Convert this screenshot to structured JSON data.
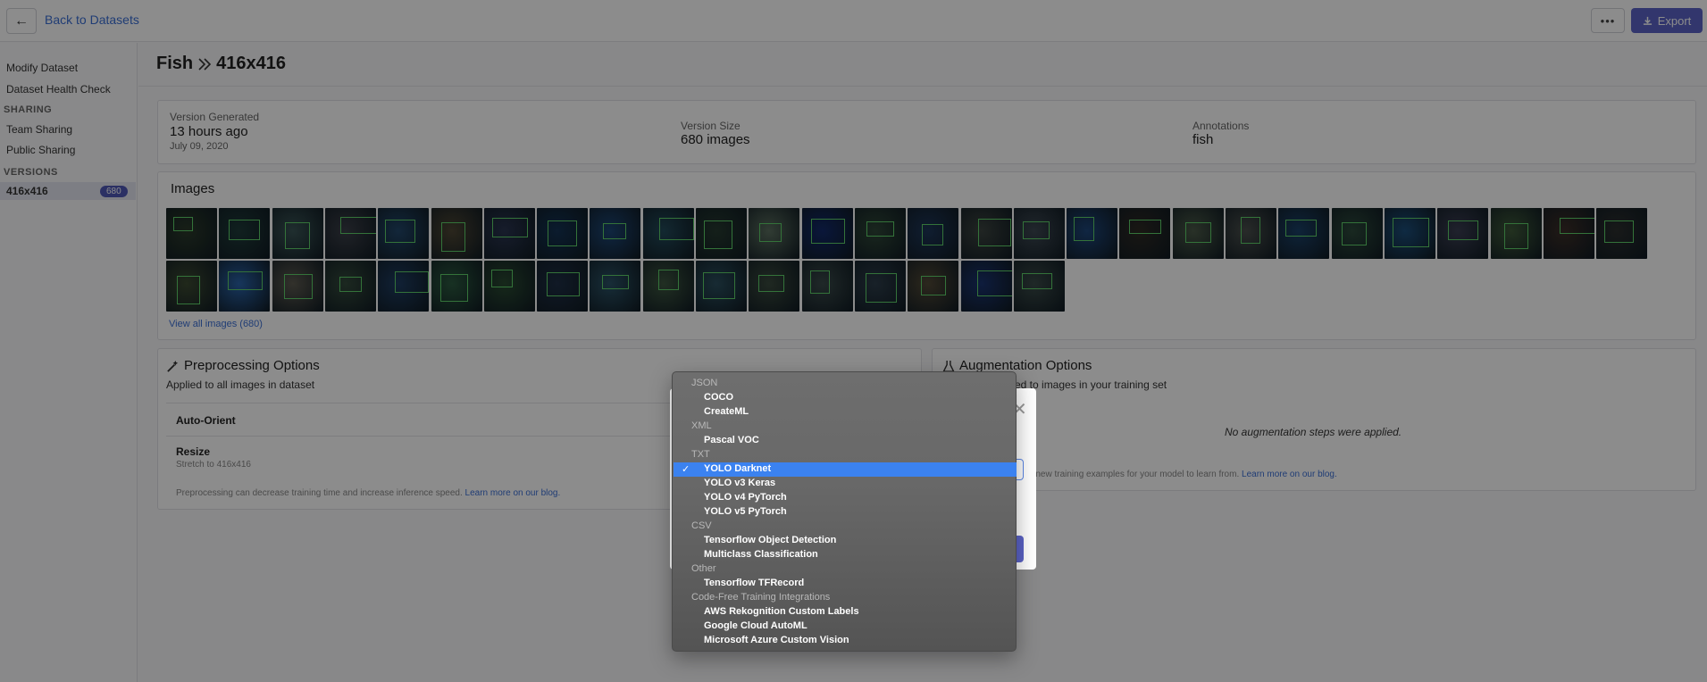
{
  "topbar": {
    "back_icon": "arrow-left-icon",
    "back_label": "Back to Datasets",
    "more_label": "•••",
    "export_label": "Export",
    "export_icon": "download-icon"
  },
  "sidebar": {
    "items_top": [
      "Modify Dataset",
      "Dataset Health Check"
    ],
    "sharing_heading": "SHARING",
    "sharing_items": [
      "Team Sharing",
      "Public Sharing"
    ],
    "versions_heading": "VERSIONS",
    "version_label": "416x416",
    "version_count": "680"
  },
  "header": {
    "dataset": "Fish",
    "version": "416x416",
    "separator_icon": "double-chevron-right-icon"
  },
  "info": {
    "generated_label": "Version Generated",
    "generated_value": "13 hours ago",
    "generated_date": "July 09, 2020",
    "size_label": "Version Size",
    "size_value": "680 images",
    "annotations_label": "Annotations",
    "annotations_value": "fish"
  },
  "images": {
    "title": "Images",
    "view_all": "View all images (680)"
  },
  "preprocessing": {
    "title": "Preprocessing Options",
    "subtitle": "Applied to all images in dataset",
    "icon": "magic-wand-icon",
    "steps": [
      {
        "name": "Auto-Orient",
        "desc": ""
      },
      {
        "name": "Resize",
        "desc": "Stretch to 416x416"
      }
    ],
    "footnote": "Preprocessing can decrease training time and increase inference speed.",
    "footnote_link": "Learn more on our blog."
  },
  "augmentation": {
    "title": "Augmentation Options",
    "subtitle_partial": "ed to images in your training set",
    "icon": "flask-icon",
    "empty": "No augmentation steps were applied.",
    "footnote_partial": "e new training examples for your model to learn from.",
    "footnote_link": "Learn more on our blog."
  },
  "dropdown": {
    "groups": [
      {
        "label": "JSON",
        "items": [
          "COCO",
          "CreateML"
        ]
      },
      {
        "label": "XML",
        "items": [
          "Pascal VOC"
        ]
      },
      {
        "label": "TXT",
        "items": [
          "YOLO Darknet",
          "YOLO v3 Keras",
          "YOLO v4 PyTorch",
          "YOLO v5 PyTorch"
        ]
      },
      {
        "label": "CSV",
        "items": [
          "Tensorflow Object Detection",
          "Multiclass Classification"
        ]
      },
      {
        "label": "Other",
        "items": [
          "Tensorflow TFRecord"
        ]
      },
      {
        "label": "Code-Free Training Integrations",
        "items": [
          "AWS Rekognition Custom Labels",
          "Google Cloud AutoML",
          "Microsoft Azure Custom Vision"
        ]
      }
    ],
    "selected": "YOLO Darknet",
    "check_icon": "checkmark-icon"
  },
  "modal": {
    "close_icon": "close-icon"
  },
  "thumbnail_colors": [
    "#2b3a2a",
    "#1f3b3a",
    "#3a5556",
    "#3b3f48",
    "#22476a",
    "#4d4634",
    "#2a3550",
    "#143354",
    "#1d4675",
    "#234a5a",
    "#263a30",
    "#5a6e5e",
    "#132a6a",
    "#2f4738",
    "#1e3658",
    "#3c4440",
    "#3d4852",
    "#1e467a",
    "#2e2a24",
    "#4b5a48",
    "#4a4f4c",
    "#1b4168",
    "#2d4a3c",
    "#1c4e7a",
    "#3a3e52",
    "#3f5a3a",
    "#3c2e28",
    "#2c2f2e",
    "#3c4a32",
    "#2a63a8",
    "#5c5a50",
    "#344a3c",
    "#1f3d62",
    "#2c5a40",
    "#2a4a32",
    "#1f2f46",
    "#2b5266",
    "#3d5640",
    "#2b4f5e",
    "#3a4a3e",
    "#3a4a4a",
    "#2d3d4a",
    "#504836",
    "#1a3470",
    "#3a4a48"
  ]
}
